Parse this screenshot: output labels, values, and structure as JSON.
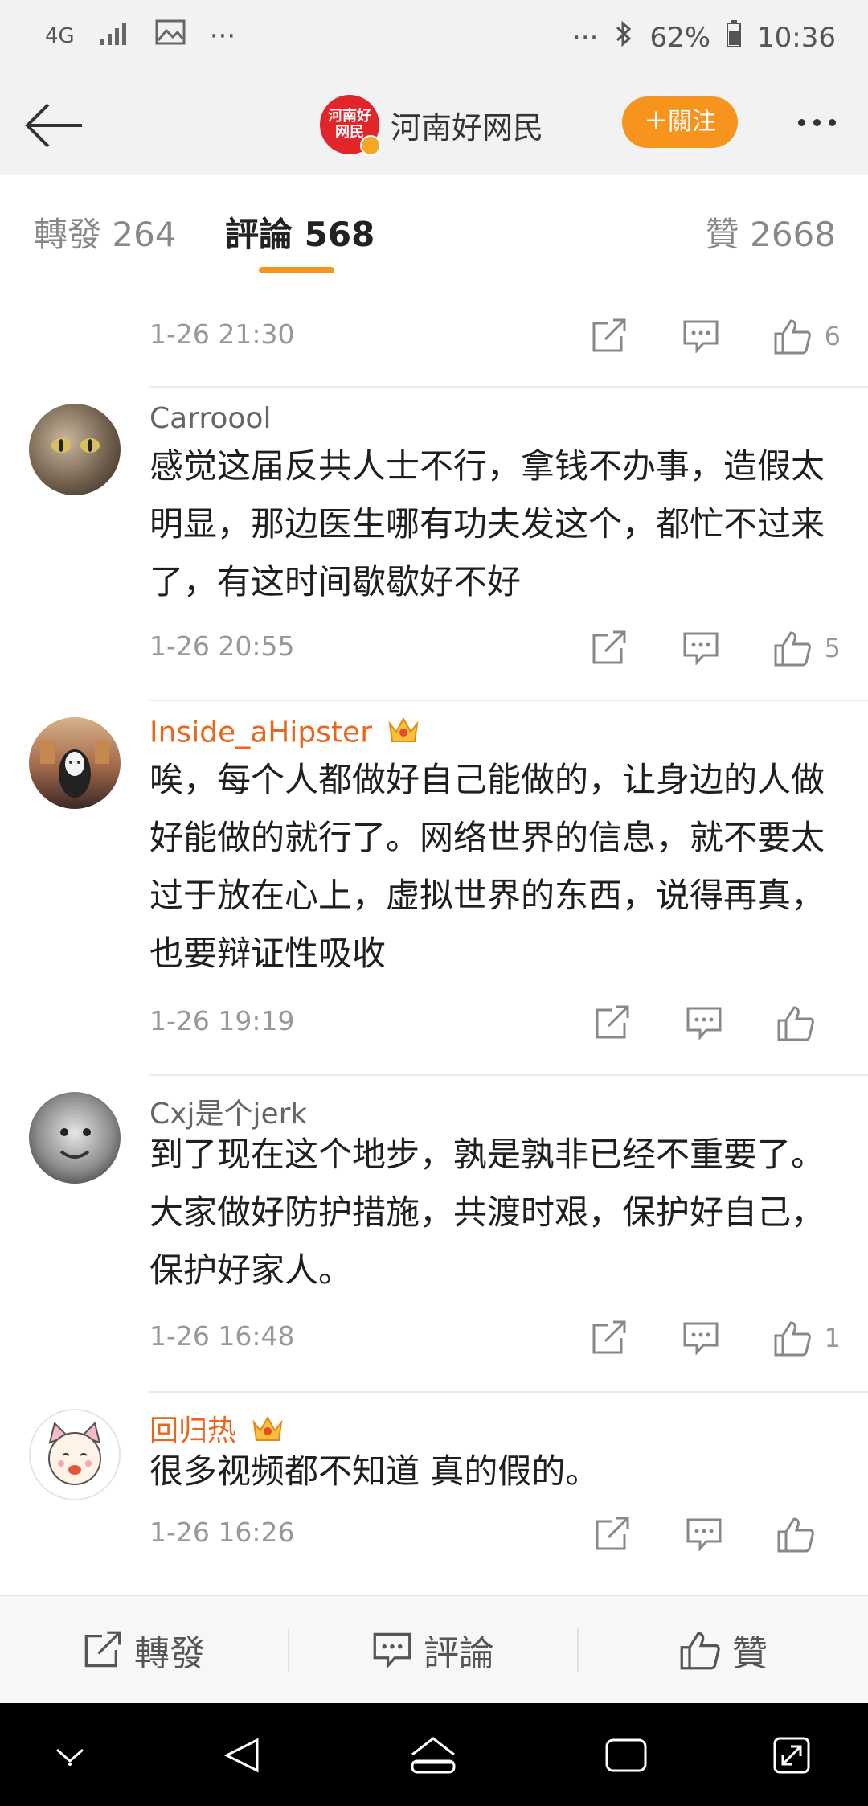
{
  "status_bar": {
    "network": "4G",
    "more": "···",
    "more_right": "···",
    "battery": "62%",
    "time": "10:36"
  },
  "header": {
    "account_name": "河南好网民",
    "avatar_text": "河南好网民",
    "follow_label": "＋關注"
  },
  "tabs": {
    "repost": "轉發 264",
    "comment": "評論 568",
    "like": "贊 2668"
  },
  "comments": [
    {
      "user": "",
      "text": "",
      "time": "1-26 21:30",
      "likes": "6"
    },
    {
      "user": "Carroool",
      "text": "感觉这届反共人士不行，拿钱不办事，造假太明显，那边医生哪有功夫发这个，都忙不过来了，有这时间歇歇好不好",
      "time": "1-26 20:55",
      "likes": "5"
    },
    {
      "user": "Inside_aHipster",
      "text": "唉，每个人都做好自己能做的，让身边的人做好能做的就行了。网络世界的信息，就不要太过于放在心上，虚拟世界的东西，说得再真，也要辩证性吸收",
      "time": "1-26 19:19",
      "likes": ""
    },
    {
      "user": "Cxj是个jerk",
      "text": "到了现在这个地步，孰是孰非已经不重要了。大家做好防护措施，共渡时艰，保护好自己，保护好家人。",
      "time": "1-26 16:48",
      "likes": "1"
    },
    {
      "user": "回归热",
      "text": "很多视频都不知道 真的假的。",
      "time": "1-26 16:26",
      "likes": ""
    }
  ],
  "bottom_bar": {
    "repost": "轉發",
    "comment": "評論",
    "like": "贊"
  },
  "colors": {
    "accent": "#f6941e",
    "vip_name": "#e8671d",
    "brand_red": "#e0262a"
  }
}
